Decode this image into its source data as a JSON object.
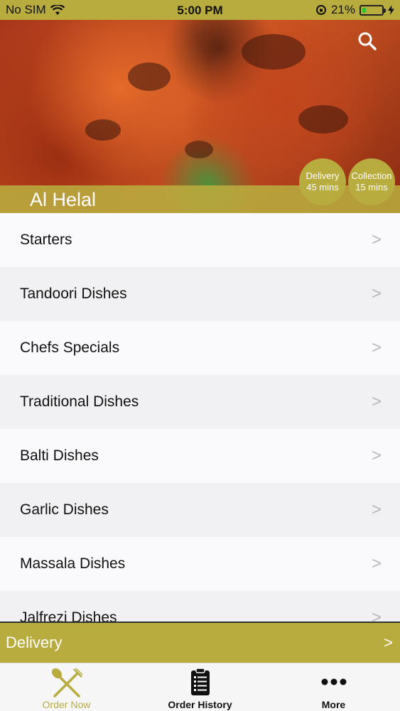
{
  "status_bar": {
    "carrier": "No SIM",
    "time": "5:00 PM",
    "battery_percent": "21%",
    "battery_level": 0.21
  },
  "hero": {
    "restaurant_name": "Al Helal",
    "delivery_badge": {
      "label": "Delivery",
      "time": "45 mins"
    },
    "collection_badge": {
      "label": "Collection",
      "time": "15 mins"
    }
  },
  "menu": {
    "items": [
      {
        "label": "Starters"
      },
      {
        "label": "Tandoori Dishes"
      },
      {
        "label": "Chefs Specials"
      },
      {
        "label": "Traditional Dishes"
      },
      {
        "label": "Balti Dishes"
      },
      {
        "label": "Garlic Dishes"
      },
      {
        "label": "Massala Dishes"
      },
      {
        "label": "Jalfrezi Dishes"
      }
    ],
    "chevron": ">"
  },
  "delivery_bar": {
    "label": "Delivery",
    "arrow": ">"
  },
  "tabs": [
    {
      "label": "Order Now",
      "icon": "fork-spoon-icon",
      "active": true
    },
    {
      "label": "Order History",
      "icon": "clipboard-list-icon",
      "active": false
    },
    {
      "label": "More",
      "icon": "more-dots-icon",
      "active": false
    }
  ],
  "colors": {
    "accent": "#b9ac3f",
    "text": "#111111",
    "chevron": "#b8b8b8"
  }
}
